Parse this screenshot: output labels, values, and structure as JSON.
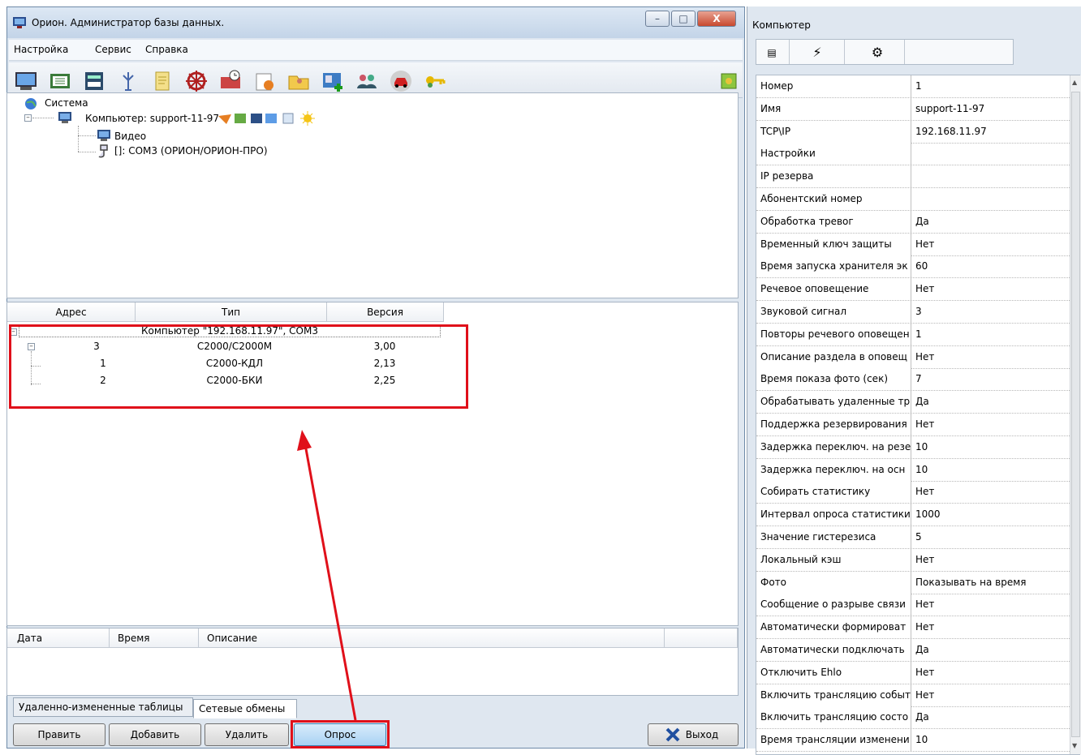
{
  "window": {
    "title": "Орион. Администратор базы данных.",
    "close_label": "X"
  },
  "menu": [
    "Настройка",
    "Сервис",
    "Справка"
  ],
  "toolbar_icons": [
    "computer-icon",
    "network-icon",
    "device-icon",
    "antenna-icon",
    "document-icon",
    "wheel-icon",
    "schedule-icon",
    "report-icon",
    "folder-user-icon",
    "add-user-icon",
    "users-icon",
    "car-icon",
    "key-icon",
    "status-icon"
  ],
  "tree": {
    "root": "Система",
    "computer": "Компьютер: support-11-97",
    "video": "Видео",
    "port": "[]: COM3 (ОРИОН/ОРИОН-ПРО)"
  },
  "device_grid": {
    "columns": [
      "Адрес",
      "Тип",
      "Версия"
    ],
    "group_label": "Компьютер \"192.168.11.97\", COM3",
    "rows": [
      {
        "address": "3",
        "type": "С2000/С2000М",
        "version": "3,00"
      },
      {
        "address": "1",
        "type": "С2000-КДЛ",
        "version": "2,13"
      },
      {
        "address": "2",
        "type": "С2000-БКИ",
        "version": "2,25"
      }
    ]
  },
  "events": {
    "columns": [
      "Дата",
      "Время",
      "Описание"
    ]
  },
  "tabs": [
    "Удаленно-измененные таблицы",
    "Сетевые обмены"
  ],
  "buttons": {
    "edit": "Править",
    "add": "Добавить",
    "delete": "Удалить",
    "poll": "Опрос",
    "exit": "Выход"
  },
  "properties": {
    "title": "Компьютер",
    "rows": [
      {
        "name": "Номер",
        "value": "1"
      },
      {
        "name": "Имя",
        "value": "support-11-97"
      },
      {
        "name": "TCP\\IP",
        "value": "192.168.11.97"
      },
      {
        "name": "Настройки",
        "value": ""
      },
      {
        "name": "IP резерва",
        "value": ""
      },
      {
        "name": "Абонентский номер",
        "value": ""
      },
      {
        "name": "Обработка тревог",
        "value": "Да"
      },
      {
        "name": "Временный ключ защиты",
        "value": "Нет"
      },
      {
        "name": "Время запуска хранителя эк",
        "value": "60"
      },
      {
        "name": "Речевое оповещение",
        "value": "Нет"
      },
      {
        "name": "Звуковой сигнал",
        "value": "3"
      },
      {
        "name": "Повторы речевого оповещен",
        "value": "1"
      },
      {
        "name": "Описание раздела в оповещ",
        "value": "Нет"
      },
      {
        "name": "Время показа фото (сек)",
        "value": "7"
      },
      {
        "name": "Обрабатывать удаленные тр",
        "value": "Да"
      },
      {
        "name": "Поддержка резервирования",
        "value": "Нет"
      },
      {
        "name": "Задержка переключ. на резе",
        "value": "10"
      },
      {
        "name": "Задержка переключ. на осн",
        "value": "10"
      },
      {
        "name": "Собирать статистику",
        "value": "Нет"
      },
      {
        "name": "Интервал опроса статистики",
        "value": "1000"
      },
      {
        "name": "Значение гистерезиса",
        "value": "5"
      },
      {
        "name": "Локальный кэш",
        "value": "Нет"
      },
      {
        "name": "Фото",
        "value": "Показывать на время"
      },
      {
        "name": "Сообщение о разрыве связи",
        "value": "Нет"
      },
      {
        "name": "Автоматически формироват",
        "value": "Нет"
      },
      {
        "name": "Автоматически подключать",
        "value": "Да"
      },
      {
        "name": "Отключить Ehlo",
        "value": "Нет"
      },
      {
        "name": "Включить трансляцию событ",
        "value": "Нет"
      },
      {
        "name": "Включить трансляцию состо",
        "value": "Да"
      },
      {
        "name": "Время трансляции изменени",
        "value": "10"
      }
    ]
  },
  "colors": {
    "highlight": "#e0101a",
    "arrow": "#e0101a"
  }
}
